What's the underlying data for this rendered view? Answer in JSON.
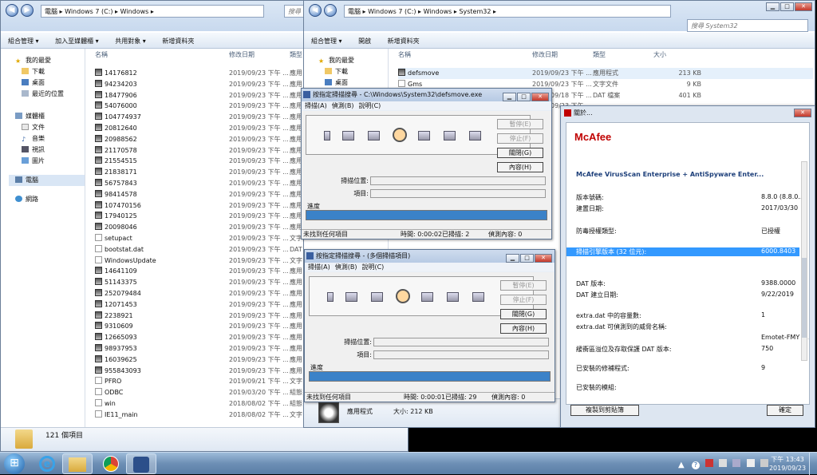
{
  "win1": {
    "back": "◀",
    "fwd": "▶",
    "breadcrumb": "電腦 ▸ Windows 7 (C:) ▸ Windows ▸",
    "search_placeholder": "搜尋 Win",
    "commands": [
      "組合管理 ▾",
      "加入至媒體櫃 ▾",
      "共用對象 ▾",
      "新增資料夾"
    ],
    "nav": {
      "favorites": "我的最愛",
      "downloads": "下載",
      "desktop": "桌面",
      "recent": "最近的位置",
      "libraries": "媒體櫃",
      "documents": "文件",
      "music": "音樂",
      "videos": "視訊",
      "pictures": "圖片",
      "computer": "電腦",
      "network": "網路"
    },
    "columns": {
      "name": "名稱",
      "date": "修改日期",
      "type": "類型"
    },
    "files": [
      {
        "name": "14176812",
        "date": "2019/09/23 下午 ...",
        "type": "應用"
      },
      {
        "name": "94234203",
        "date": "2019/09/23 下午 ...",
        "type": "應用"
      },
      {
        "name": "18477906",
        "date": "2019/09/23 下午 ...",
        "type": "應用"
      },
      {
        "name": "54076000",
        "date": "2019/09/23 下午 ...",
        "type": "應用"
      },
      {
        "name": "104774937",
        "date": "2019/09/23 下午 ...",
        "type": "應用"
      },
      {
        "name": "20812640",
        "date": "2019/09/23 下午 ...",
        "type": "應用"
      },
      {
        "name": "20988562",
        "date": "2019/09/23 下午 ...",
        "type": "應用"
      },
      {
        "name": "21170578",
        "date": "2019/09/23 下午 ...",
        "type": "應用"
      },
      {
        "name": "21554515",
        "date": "2019/09/23 下午 ...",
        "type": "應用"
      },
      {
        "name": "21838171",
        "date": "2019/09/23 下午 ...",
        "type": "應用"
      },
      {
        "name": "56757843",
        "date": "2019/09/23 下午 ...",
        "type": "應用"
      },
      {
        "name": "98414578",
        "date": "2019/09/23 下午 ...",
        "type": "應用"
      },
      {
        "name": "107470156",
        "date": "2019/09/23 下午 ...",
        "type": "應用"
      },
      {
        "name": "17940125",
        "date": "2019/09/23 下午 ...",
        "type": "應用"
      },
      {
        "name": "20098046",
        "date": "2019/09/23 下午 ...",
        "type": "應用"
      },
      {
        "name": "setupact",
        "date": "2019/09/23 下午 ...",
        "type": "文字"
      },
      {
        "name": "bootstat.dat",
        "date": "2019/09/23 下午 ...",
        "type": "DAT"
      },
      {
        "name": "WindowsUpdate",
        "date": "2019/09/23 下午 ...",
        "type": "文字"
      },
      {
        "name": "14641109",
        "date": "2019/09/23 下午 ...",
        "type": "應用"
      },
      {
        "name": "51143375",
        "date": "2019/09/23 下午 ...",
        "type": "應用"
      },
      {
        "name": "252079484",
        "date": "2019/09/23 下午 ...",
        "type": "應用"
      },
      {
        "name": "12071453",
        "date": "2019/09/23 下午 ...",
        "type": "應用"
      },
      {
        "name": "2238921",
        "date": "2019/09/23 下午 ...",
        "type": "應用"
      },
      {
        "name": "9310609",
        "date": "2019/09/23 下午 ...",
        "type": "應用"
      },
      {
        "name": "12665093",
        "date": "2019/09/23 下午 ...",
        "type": "應用"
      },
      {
        "name": "98937953",
        "date": "2019/09/23 下午 ...",
        "type": "應用"
      },
      {
        "name": "16039625",
        "date": "2019/09/23 下午 ...",
        "type": "應用"
      },
      {
        "name": "955843093",
        "date": "2019/09/23 下午 ...",
        "type": "應用"
      },
      {
        "name": "PFRO",
        "date": "2019/09/21 下午 ...",
        "type": "文字"
      },
      {
        "name": "ODBC",
        "date": "2019/03/20 下午 ...",
        "type": "組態"
      },
      {
        "name": "win",
        "date": "2018/08/02 下午 ...",
        "type": "組態"
      },
      {
        "name": "IE11_main",
        "date": "2018/08/02 下午 ...",
        "type": "文字"
      }
    ],
    "status": "121 個項目"
  },
  "win2": {
    "breadcrumb": "電腦 ▸ Windows 7 (C:) ▸ Windows ▸ System32 ▸",
    "search_placeholder": "搜尋 System32",
    "title_buttons": [
      "▁",
      "□",
      "✕"
    ],
    "commands": [
      "組合管理 ▾",
      "開啟",
      "新增資料夾"
    ],
    "nav": {
      "favorites": "我的最愛",
      "downloads": "下載",
      "desktop": "桌面"
    },
    "columns": {
      "name": "名稱",
      "date": "修改日期",
      "type": "類型",
      "size": "大小"
    },
    "files": [
      {
        "name": "defsmove",
        "date": "2019/09/23 下午 ...",
        "type": "應用程式",
        "size": "213 KB"
      },
      {
        "name": "Gms",
        "date": "2019/09/23 下午 ...",
        "type": "文字文件",
        "size": "9 KB"
      },
      {
        "name": "",
        "date": "2019/09/18 下午 ...",
        "type": "DAT 檔案",
        "size": "401 KB"
      },
      {
        "name": "",
        "date": "2019/09/23 下午 ...",
        "type": "",
        "size": ""
      }
    ],
    "details": {
      "type": "應用程式",
      "size": "大小: 212 KB"
    }
  },
  "scan1": {
    "title": "按指定掃描搜尋 - C:\\Windows\\System32\\defsmove.exe",
    "menu": [
      "掃描(A)",
      "偵測(B)",
      "說明(C)"
    ],
    "buttons": {
      "pause": "暫停(E)",
      "stop": "停止(F)",
      "close": "關閉(G)",
      "content": "內容(H)"
    },
    "scan_location": "掃描位置:",
    "item": "項目:",
    "progress_label": "進度",
    "progress": 1.0,
    "status": {
      "found": "未找到任何項目",
      "time": "時間: 0:00:02",
      "scanned": "已掃描: 2",
      "detected": "偵測內容: 0"
    }
  },
  "scan2": {
    "title": "按指定掃描搜尋 - (多個掃描項目)",
    "menu": [
      "掃描(A)",
      "偵測(B)",
      "說明(C)"
    ],
    "buttons": {
      "pause": "暫停(E)",
      "stop": "停止(F)",
      "close": "關閉(G)",
      "content": "內容(H)"
    },
    "scan_location": "掃描位置:",
    "item": "項目:",
    "progress_label": "進度",
    "progress": 1.0,
    "status": {
      "found": "未找到任何項目",
      "time": "時間: 0:00:01",
      "scanned": "已掃描: 29",
      "detected": "偵測內容: 0"
    }
  },
  "mcafee": {
    "title": "關於...",
    "logo": "McAfee",
    "product": "McAfee VirusScan Enterprise + AntiSpyware Enter...",
    "rows": [
      {
        "label": "版本號碼:",
        "value": "8.8.0 (8.8.0..."
      },
      {
        "label": "建置日期:",
        "value": "2017/03/30"
      },
      {
        "label": "防毒授權類型:",
        "value": "已授權"
      },
      {
        "label": "掃描引擎版本 (32 位元):",
        "value": "6000.8403"
      },
      {
        "label": "DAT 版本:",
        "value": "9388.0000"
      },
      {
        "label": "DAT 建立日期:",
        "value": "9/22/2019"
      },
      {
        "label": "extra.dat 中的容量數:",
        "value": "1"
      },
      {
        "label": "extra.dat 可偵測到的威脅名稱:",
        "value": ""
      },
      {
        "label": "",
        "value": "Emotet-FMY (..."
      },
      {
        "label": "緩衝區溢位及存取保護 DAT 版本:",
        "value": "750"
      },
      {
        "label": "已安裝的修補程式:",
        "value": "9"
      },
      {
        "label": "已安裝的模組:",
        "value": ""
      }
    ],
    "copy_button": "複製到剪貼簿",
    "ok_button": "確定"
  },
  "taskbar": {
    "time": "下午 13:43",
    "date": "2019/09/23",
    "start": "⊞"
  },
  "colors": {
    "accent": "#3b82c8",
    "mcafee_red": "#c00000",
    "selection": "#3399ff"
  }
}
